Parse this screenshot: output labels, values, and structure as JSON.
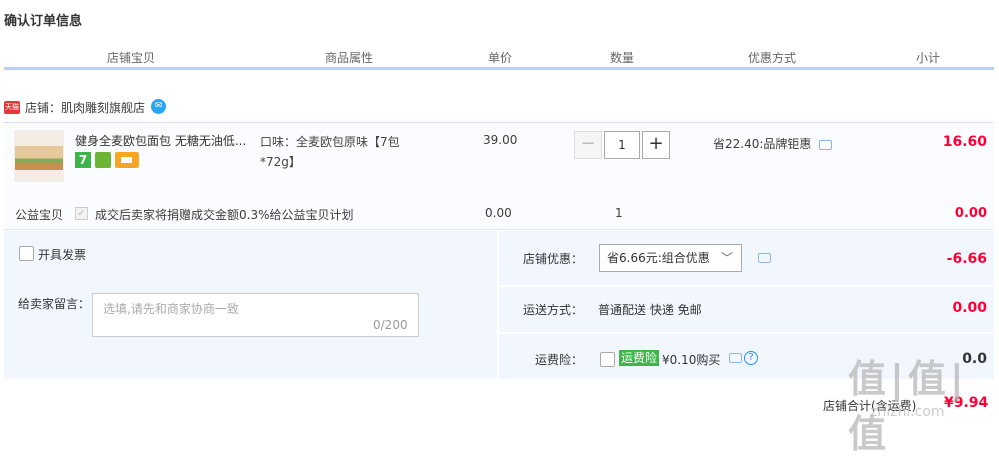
{
  "page_title": "确认订单信息",
  "columns": [
    "店铺宝贝",
    "商品属性",
    "单价",
    "数量",
    "优惠方式",
    "小计"
  ],
  "shop": {
    "badge": "天猫",
    "label": "店铺：肌肉雕刻旗舰店"
  },
  "item": {
    "name": "健身全麦欧包面包 无糖无油低...",
    "attr": "口味：全麦欧包原味【7包*72g】",
    "price": "39.00",
    "qty": "1",
    "promo": "省22.40:品牌钜惠",
    "subtotal": "16.60",
    "badges": [
      "7",
      "green-icon",
      "card-icon"
    ]
  },
  "charity": {
    "label": "公益宝贝",
    "text": "成交后卖家将捐赠成交金额0.3%给公益宝贝计划",
    "price": "0.00",
    "qty": "1",
    "subtotal": "0.00"
  },
  "invoice_label": "开具发票",
  "message": {
    "label": "给卖家留言：",
    "placeholder": "选填,请先和商家协商一致",
    "count": "0/200"
  },
  "store_discount": {
    "label": "店铺优惠：",
    "selected": "省6.66元:组合优惠",
    "amount": "-6.66"
  },
  "shipping": {
    "label": "运送方式：",
    "value": "普通配送 快递 免邮",
    "amount": "0.00"
  },
  "insurance": {
    "label": "运费险：",
    "tag": "运费险",
    "text": "¥0.10购买",
    "amount": "0.0"
  },
  "total": {
    "label": "店铺合计(含运费)",
    "value": "¥9.94"
  },
  "watermark": {
    "text": "值|值|值",
    "domain": "zhizhi.com"
  },
  "colors": {
    "accent_red": "#ff0036",
    "header_line": "#b2d1ff",
    "panel_bg": "#f2f7ff"
  }
}
